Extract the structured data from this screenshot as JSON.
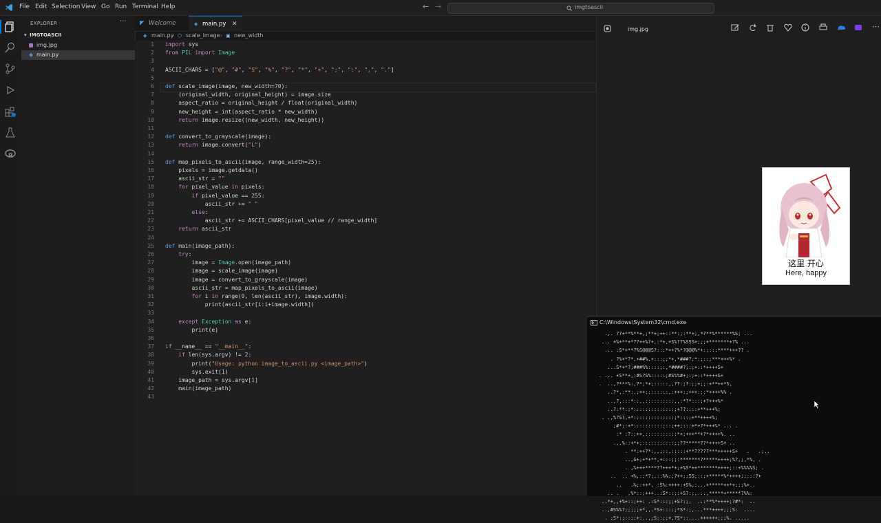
{
  "menu": [
    "File",
    "Edit",
    "Selection",
    "View",
    "Go",
    "Run",
    "Terminal",
    "Help"
  ],
  "search": {
    "text": "imgtoascii"
  },
  "explorer": {
    "header": "EXPLORER",
    "folder": "IMGTOASCII",
    "files": [
      "img.jpg",
      "main.py"
    ]
  },
  "tabs": [
    {
      "label": "Welcome"
    },
    {
      "label": "main.py"
    }
  ],
  "breadcrumb": [
    "main.py",
    "scale_image",
    "new_width"
  ],
  "code": [
    "import sys",
    "from PIL import Image",
    "",
    "ASCII_CHARS = [\"@\", \"#\", \"S\", \"%\", \"?\", \"*\", \"+\", \";\", \":\", \",\", \".\"]",
    "",
    "def scale_image(image, new_width=70):",
    "    (original_width, original_height) = image.size",
    "    aspect_ratio = original_height / float(original_width)",
    "    new_height = int(aspect_ratio * new_width)",
    "    return image.resize((new_width, new_height))",
    "",
    "def convert_to_grayscale(image):",
    "    return image.convert(\"L\")",
    "",
    "def map_pixels_to_ascii(image, range_width=25):",
    "    pixels = image.getdata()",
    "    ascii_str = \"\"",
    "    for pixel_value in pixels:",
    "        if pixel_value == 255:",
    "            ascii_str += \" \"",
    "        else:",
    "            ascii_str += ASCII_CHARS[pixel_value // range_width]",
    "    return ascii_str",
    "",
    "def main(image_path):",
    "    try:",
    "        image = Image.open(image_path)",
    "        image = scale_image(image)",
    "        image = convert_to_grayscale(image)",
    "        ascii_str = map_pixels_to_ascii(image)",
    "        for i in range(0, len(ascii_str), image.width):",
    "            print(ascii_str[i:i+image.width])",
    "",
    "    except Exception as e:",
    "        print(e)",
    "",
    "if __name__ == \"__main__\":",
    "    if len(sys.argv) != 2:",
    "        print(\"Usage: python image_to_ascii.py <image_path>\")",
    "        sys.exit(1)",
    "    image_path = sys.argv[1]",
    "    main(image_path)",
    ""
  ],
  "viewer": {
    "title": "img.jpg",
    "caption_cn": "这里 开心",
    "caption_en": "Here, happy"
  },
  "cmd": {
    "title": "C:\\Windows\\System32\\cmd.exe",
    "lines": [
      "      .,. ??+**%**+,;**+;++::**:;:**+;,*?**%******%S; ...",
      "     ... +%+**+*??++%?+,:*+,+S%??%SSS+;;;+*******+?% ...",
      "      ... :S*+**?%S@@@S?:::*++?%*?@@@%*+:;::;****+++?? .",
      "        . ?%+*?*,+##%,+:::;;*+,*###?;*:;::;***+++%* .",
      "       ...S*+*?;###%%::::;:,*####?;:;+::*++++S+",
      "    . ... +S**+,:#S?S%:::::;#S%%#+;:;+::*++++S+",
      "    .  ..,?***%:,?*;*+;:::::,,??:;?:;;+;;:+**++*S,",
      "       ..?*,:**:,;++::::::::,:+++:;+++:::*++++%% .",
      "       ..,?,:::*::,,::::::::::,,:*?*:::;+?+++%*",
      "       ..?:**:;*::::::::::::::;+??::::+**+++%;",
      "     . .,%?S?,+*::::::::::::::;*:::;+**++++%;",
      "         ;#*;:+*::::::::::;::;++;:::+*+?*+++%* ... .",
      "          :* :?:;++,:::::::::::*+;+++**+?*++++%. ..",
      "         .,,%::+*+;:::::::::::;;??*****??*++++S+ ..",
      "             . **:++?*:,,;::,:::::+**?????***+++++S+   .   .;..",
      "             ..,S+;+*+**,+:::;;:*******?*****++++;%?,;,*%, .",
      "             . ,%+++****??+++*+;+%S*++*******++++;::+%%%%S; .",
      "        ..  .. +%,:;*?;,::%%;;?++;;SS;::;+*****%*++++;;:::?+",
      "          ..   .%;:++*, :S%:++++:+S%,;,..+*****++*+;;;%+..",
      "       .. .   ,%*::;+++..:S*::;:+S?:;,...,*****+*****?%%:",
      "     ..*+,,+%+::;++: .:S*:::;;+S?:;,  ..:**%*++++;?#*:  ..",
      "     ..,#S%%?;;;;;+*,,.*S+::::;*S*:;,...***++++;;;S:  ....",
      "      . ;S*:;::;;+:..,;S::;;+,?S*::....++++++;;;%. ....."
    ]
  },
  "colors": {
    "accent": "#0078d4",
    "editor_bg": "#1f1f1f",
    "cmd_bg": "#0c0c0c"
  }
}
